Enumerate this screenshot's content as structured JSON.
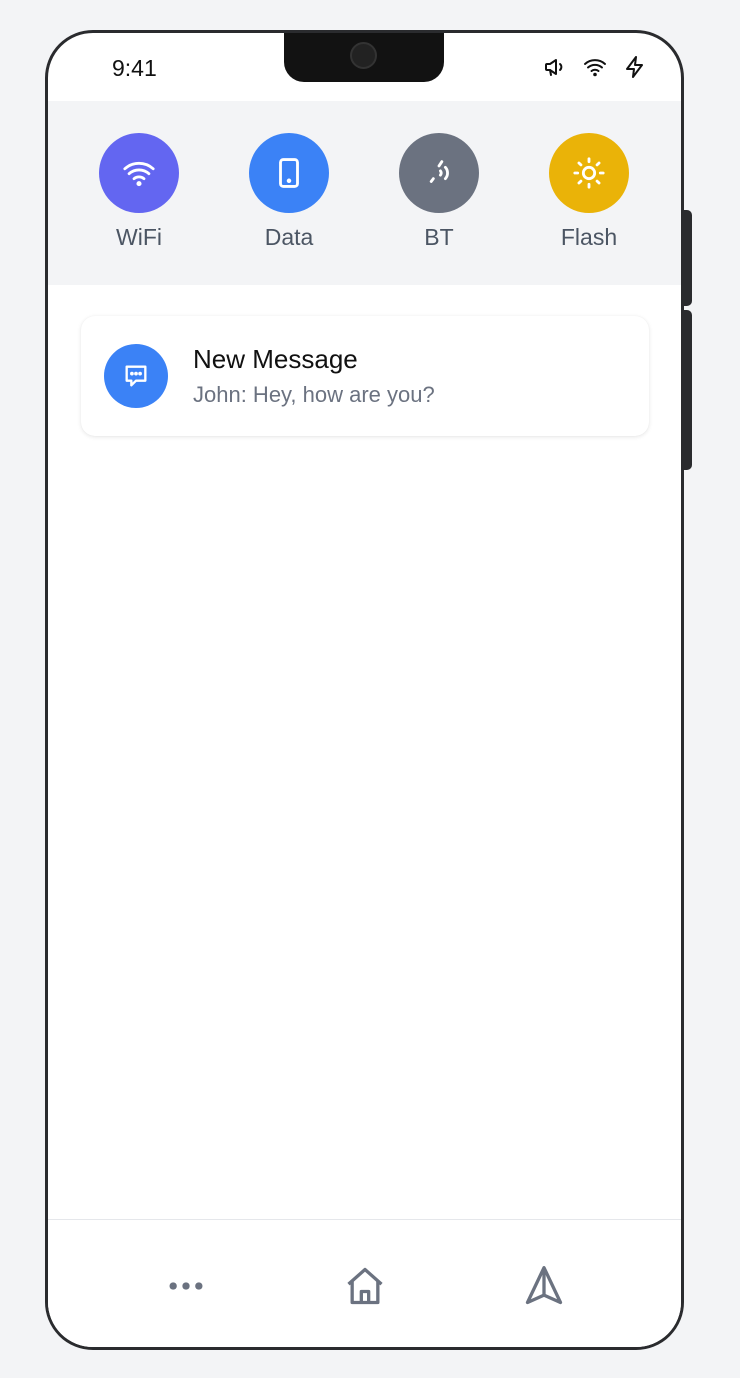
{
  "status_bar": {
    "time": "9:41",
    "icons": [
      "megaphone-icon",
      "wifi-icon",
      "bolt-icon"
    ]
  },
  "quick_toggles": [
    {
      "label": "WiFi",
      "icon": "wifi-icon",
      "color": "#6366f1"
    },
    {
      "label": "Data",
      "icon": "phone-icon",
      "color": "#3b82f6"
    },
    {
      "label": "BT",
      "icon": "bluetooth-icon",
      "color": "#6b7280"
    },
    {
      "label": "Flash",
      "icon": "sun-icon",
      "color": "#eab308"
    }
  ],
  "notification": {
    "title": "New Message",
    "body": "John: Hey, how are you?",
    "icon": "chat-bubble-icon",
    "color": "#3b82f6"
  },
  "bottom_nav": {
    "items": [
      "more-icon",
      "home-icon",
      "navigate-icon"
    ],
    "icon_color": "#6b7280"
  }
}
